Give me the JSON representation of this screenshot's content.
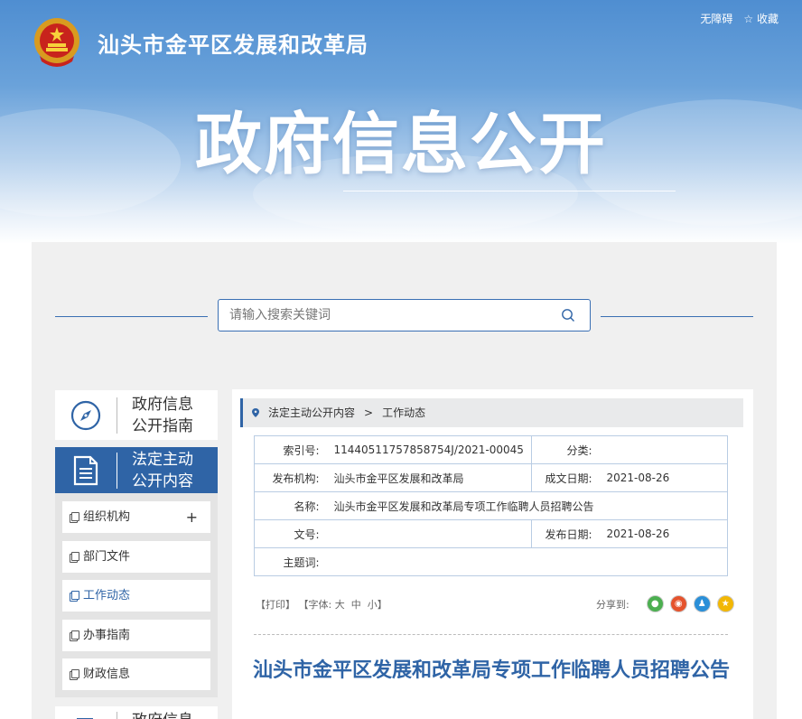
{
  "header": {
    "site_title": "汕头市金平区发展和改革局",
    "accessibility_link": "无障碍",
    "favorite_link": "收藏",
    "banner_title": "政府信息公开"
  },
  "search": {
    "placeholder": "请输入搜索关键词",
    "value": ""
  },
  "sidebar": {
    "guide_label": "政府信息公开指南",
    "guide_line1": "政府信息",
    "guide_line2": "公开指南",
    "statutory_line1": "法定主动",
    "statutory_line2": "公开内容",
    "items": [
      {
        "label": "组织机构",
        "expandable": "+"
      },
      {
        "label": "部门文件"
      },
      {
        "label": "工作动态"
      },
      {
        "label": "办事指南"
      },
      {
        "label": "财政信息"
      }
    ],
    "bottom_line1": "政府信息"
  },
  "breadcrumb": {
    "level1": "法定主动公开内容",
    "separator": ">",
    "level2": "工作动态"
  },
  "meta": {
    "index_label": "索引号:",
    "index_value": "11440511757858754J/2021-00045",
    "category_label": "分类:",
    "category_value": "",
    "publisher_label": "发布机构:",
    "publisher_value": "汕头市金平区发展和改革局",
    "written_date_label": "成文日期:",
    "written_date_value": "2021-08-26",
    "name_label": "名称:",
    "name_value": "汕头市金平区发展和改革局专项工作临聘人员招聘公告",
    "docno_label": "文号:",
    "docno_value": "",
    "publish_date_label": "发布日期:",
    "publish_date_value": "2021-08-26",
    "subject_label": "主题词:",
    "subject_value": ""
  },
  "tools": {
    "print": "【打印】",
    "font_prefix": "【字体:",
    "font_large": "大",
    "font_medium": "中",
    "font_small": "小",
    "font_suffix": "】",
    "share_label": "分享到:"
  },
  "article": {
    "title": "汕头市金平区发展和改革局专项工作临聘人员招聘公告"
  },
  "colors": {
    "accent": "#2f64a6",
    "wechat": "#4caf50",
    "weibo": "#e5532d",
    "qq": "#2a8fd8",
    "qzone": "#f2b705"
  }
}
